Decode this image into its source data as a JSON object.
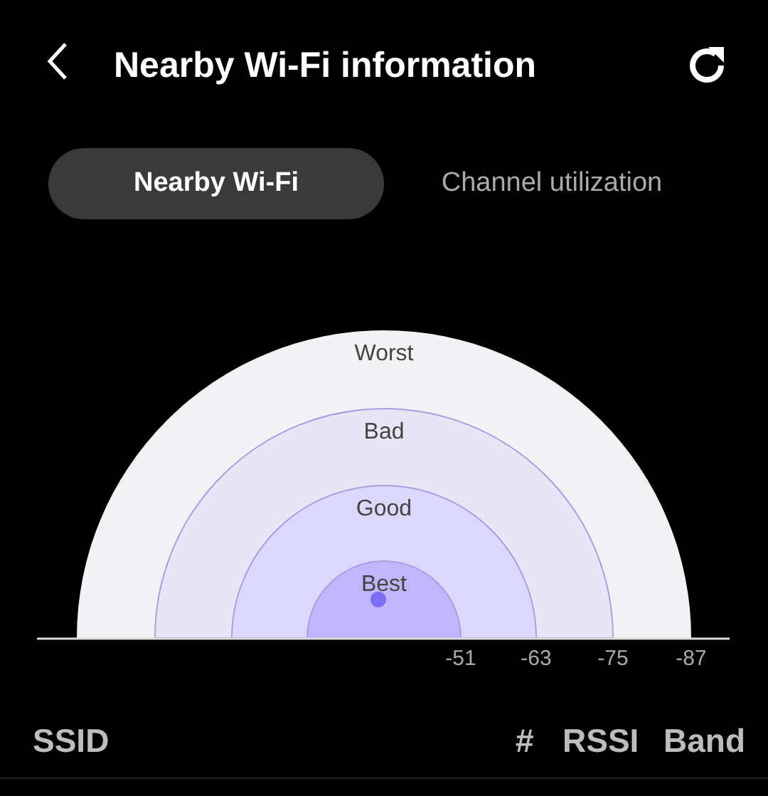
{
  "header": {
    "title": "Nearby Wi-Fi information"
  },
  "tabs": [
    {
      "label": "Nearby Wi-Fi",
      "selected": true
    },
    {
      "label": "Channel utilization",
      "selected": false
    }
  ],
  "signal_zones": [
    {
      "label": "Worst",
      "color": "#f2f2f4"
    },
    {
      "label": "Bad",
      "color": "#e7e5f6"
    },
    {
      "label": "Good",
      "color": "#dcd8fb"
    },
    {
      "label": "Best",
      "color": "#c1b6fd"
    }
  ],
  "rssi_ticks": [
    "-51",
    "-63",
    "-75",
    "-87"
  ],
  "columns": [
    "SSID",
    "#",
    "RSSI",
    "Band"
  ]
}
